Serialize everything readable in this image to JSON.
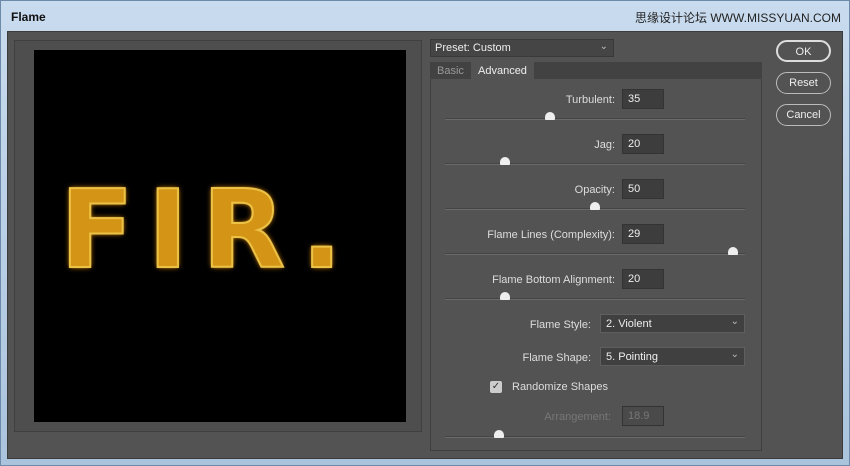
{
  "window": {
    "title": "Flame",
    "watermark": "思缘设计论坛 WWW.MISSYUAN.COM"
  },
  "preview": {
    "text": "FIR."
  },
  "preset": {
    "label": "Preset: Custom"
  },
  "tabs": [
    {
      "label": "Basic",
      "active": false
    },
    {
      "label": "Advanced",
      "active": true
    }
  ],
  "sliders": [
    {
      "label": "Turbulent:",
      "value": "35",
      "fraction": 0.35
    },
    {
      "label": "Jag:",
      "value": "20",
      "fraction": 0.2
    },
    {
      "label": "Opacity:",
      "value": "50",
      "fraction": 0.5
    },
    {
      "label": "Flame Lines (Complexity):",
      "value": "29",
      "fraction": 0.96
    },
    {
      "label": "Flame Bottom Alignment:",
      "value": "20",
      "fraction": 0.2
    }
  ],
  "flame_style": {
    "label": "Flame Style:",
    "value": "2. Violent"
  },
  "flame_shape": {
    "label": "Flame Shape:",
    "value": "5. Pointing"
  },
  "randomize": {
    "label": "Randomize Shapes",
    "checked": true
  },
  "arrangement": {
    "label": "Arrangement:",
    "value": "18.9",
    "fraction": 0.18,
    "disabled": true
  },
  "buttons": {
    "ok": "OK",
    "reset": "Reset",
    "cancel": "Cancel"
  }
}
